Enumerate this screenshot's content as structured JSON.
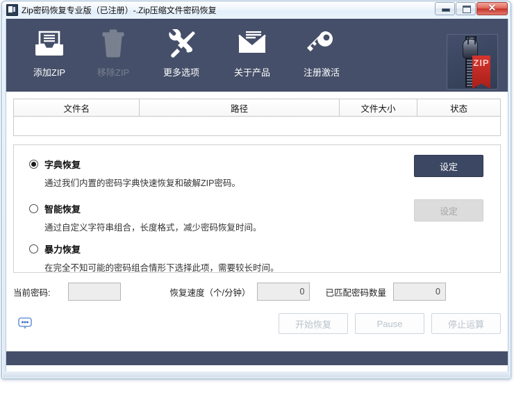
{
  "window": {
    "title": "Zip密码恢复专业版（已注册）-.Zip压缩文件密码恢复",
    "title_ghost": "",
    "app_icon": "zip-app-icon",
    "controls": {
      "minimize": "minimize-icon",
      "maximize": "maximize-icon",
      "close": "✕"
    }
  },
  "toolbar": {
    "background_color": "#454f69",
    "items": [
      {
        "label": "添加ZIP",
        "icon": "add-zip-icon",
        "enabled": true
      },
      {
        "label": "移除ZIP",
        "icon": "trash-icon",
        "enabled": false
      },
      {
        "label": "更多选项",
        "icon": "tools-icon",
        "enabled": true
      },
      {
        "label": "关于产品",
        "icon": "envelope-icon",
        "enabled": true
      },
      {
        "label": "注册激活",
        "icon": "key-icon",
        "enabled": true
      }
    ],
    "logo": {
      "text": "ZIP",
      "icon": "zipper-logo",
      "accent_color": "#c6302a"
    }
  },
  "file_list": {
    "columns": [
      {
        "label": "文件名"
      },
      {
        "label": "路径"
      },
      {
        "label": "文件大小"
      },
      {
        "label": "状态"
      }
    ],
    "rows": []
  },
  "recovery_options": {
    "selected_index": 0,
    "items": [
      {
        "title": "字典恢复",
        "description": "通过我们内置的密码字典快速恢复和破解ZIP密码。",
        "selected": true,
        "settings_label": "设定",
        "settings_enabled": true
      },
      {
        "title": "智能恢复",
        "description": "通过自定义字符串组合，长度格式，减少密码恢复时间。",
        "selected": false,
        "settings_label": "设定",
        "settings_enabled": false
      },
      {
        "title": "暴力恢复",
        "description": "在完全不知可能的密码组合情形下选择此项，需要较长时间。",
        "selected": false
      }
    ]
  },
  "status": {
    "current_password_label": "当前密码:",
    "current_password_value": "",
    "speed_label": "恢复速度（个/分钟）",
    "speed_value": "0",
    "matched_label": "已匹配密码数量",
    "matched_value": "0"
  },
  "actions": {
    "chat_icon": "speech-bubble-icon",
    "buttons": [
      {
        "label": "开始恢复",
        "enabled": false
      },
      {
        "label": "Pause",
        "enabled": false
      },
      {
        "label": "停止运算",
        "enabled": false
      }
    ]
  },
  "colors": {
    "panel_dark": "#454f69",
    "primary_button": "#3c4863",
    "disabled_button": "#dcdcdc",
    "window_border": "#9dbbd6"
  }
}
